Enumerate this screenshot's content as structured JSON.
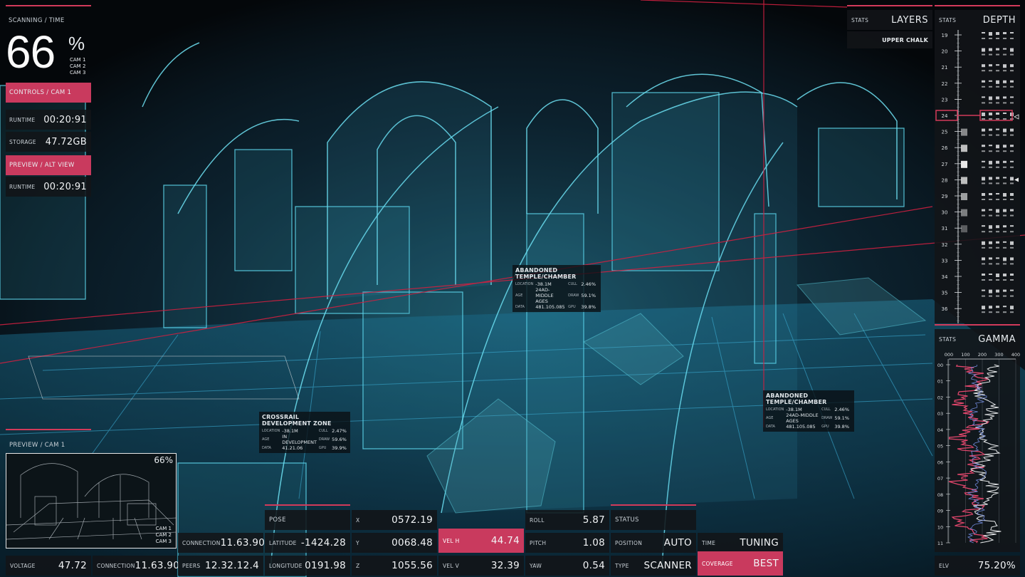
{
  "scan": {
    "header": "SCANNING / TIME",
    "percent": "66",
    "percent_sign": "%",
    "cams": [
      "CAM 1",
      "CAM 2",
      "CAM 3"
    ]
  },
  "controls": {
    "title": "CONTROLS / CAM 1",
    "runtime_label": "RUNTIME",
    "runtime_value": "00:20:91",
    "storage_label": "STORAGE",
    "storage_value": "47.72GB"
  },
  "preview_alt": {
    "title": "PREVIEW / ALT VIEW",
    "runtime_label": "RUNTIME",
    "runtime_value": "00:20:91"
  },
  "preview_cam": {
    "title": "PREVIEW / CAM 1",
    "percent": "66%",
    "cams": [
      "CAM 1",
      "CAM 2",
      "CAM 3"
    ]
  },
  "bottom_left": {
    "voltage_label": "VOLTAGE",
    "voltage_value": "47.72",
    "connection_label": "CONNECTION",
    "connection_value": "11.63.90",
    "connection2_label": "CONNECTION",
    "connection2_value": "11.63.90",
    "peers_label": "PEERS",
    "peers_value": "12.32.12.4"
  },
  "pose": {
    "title": "POSE",
    "latitude_label": "LATITUDE",
    "latitude_value": "-1424.28",
    "longitude_label": "LONGITUDE",
    "longitude_value": "0191.98",
    "x_label": "X",
    "x_value": "0572.19",
    "y_label": "Y",
    "y_value": "0068.48",
    "z_label": "Z",
    "z_value": "1055.56",
    "velh_label": "VEL H",
    "velh_value": "44.74",
    "velv_label": "VEL V",
    "velv_value": "32.39",
    "roll_label": "ROLL",
    "roll_value": "5.87",
    "pitch_label": "PITCH",
    "pitch_value": "1.08",
    "yaw_label": "YAW",
    "yaw_value": "0.54"
  },
  "status": {
    "title": "STATUS",
    "position_label": "POSITION",
    "position_value": "AUTO",
    "type_label": "TYPE",
    "type_value": "SCANNER",
    "time_label": "TIME",
    "time_value": "TUNING",
    "coverage_label": "COVERAGE",
    "coverage_value": "BEST"
  },
  "layers": {
    "stats_label": "STATS",
    "title": "LAYERS",
    "item": "UPPER CHALK"
  },
  "depth": {
    "stats_label": "STATS",
    "title": "DEPTH",
    "ticks": [
      "19",
      "20",
      "21",
      "22",
      "23",
      "24",
      "25",
      "26",
      "27",
      "28",
      "29",
      "30",
      "31",
      "32",
      "33",
      "34",
      "35",
      "36"
    ]
  },
  "gamma": {
    "stats_label": "STATS",
    "title": "GAMMA",
    "x_ticks": [
      "000",
      "100",
      "200",
      "300",
      "400"
    ],
    "y_ticks": [
      "00",
      "01",
      "02",
      "03",
      "04",
      "05",
      "06",
      "07",
      "08",
      "09",
      "10",
      "11"
    ],
    "elv_label": "ELV",
    "elv_value": "75.20%"
  },
  "overlays": [
    {
      "title": "ABANDONED TEMPLE/CHAMBER",
      "rows": [
        [
          "LOCATION",
          "-38.1M",
          "CULL",
          "2.46%"
        ],
        [
          "AGE",
          "24AD-MIDDLE AGES",
          "DRAW",
          "59.1%"
        ],
        [
          "DATA",
          "481.105.085",
          "GPU",
          "39.8%"
        ]
      ]
    },
    {
      "title": "ABANDONED TEMPLE/CHAMBER",
      "rows": [
        [
          "LOCATION",
          "-38.1M",
          "CULL",
          "2.46%"
        ],
        [
          "AGE",
          "24AD-MIDDLE AGES",
          "DRAW",
          "59.1%"
        ],
        [
          "DATA",
          "481.105.085",
          "GPU",
          "39.8%"
        ]
      ]
    },
    {
      "title": "CROSSRAIL DEVELOPMENT ZONE",
      "rows": [
        [
          "LOCATION",
          "-38.1M",
          "CULL",
          "2.47%"
        ],
        [
          "AGE",
          "IN DEVELOPMENT",
          "DRAW",
          "59.6%"
        ],
        [
          "DATA",
          "41.21.06",
          "GPU",
          "39.9%"
        ]
      ]
    }
  ],
  "colors": {
    "accent": "#c93a5e",
    "wire": "#4fd6e8",
    "panel": "#121418"
  }
}
